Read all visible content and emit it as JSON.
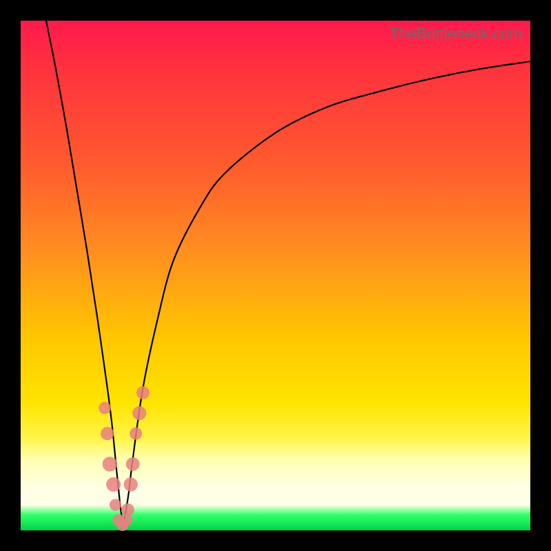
{
  "watermark": "TheBottleneck.com",
  "colors": {
    "frame": "#000000",
    "gradient_top": "#ff1a4d",
    "gradient_mid": "#ffc600",
    "gradient_band": "#ffffe8",
    "gradient_bottom": "#00d34a",
    "curve": "#000000",
    "dots": "#e98080"
  },
  "chart_data": {
    "type": "line",
    "title": "",
    "xlabel": "",
    "ylabel": "",
    "xlim": [
      0,
      100
    ],
    "ylim": [
      0,
      100
    ],
    "grid": false,
    "legend": false,
    "series": [
      {
        "name": "bottleneck-curve",
        "x": [
          5,
          7,
          9,
          11,
          13,
          15,
          17,
          18,
          19,
          20,
          21,
          22,
          24,
          27,
          30,
          35,
          40,
          50,
          60,
          70,
          80,
          90,
          100
        ],
        "y": [
          100,
          90,
          79,
          67,
          55,
          42,
          28,
          20,
          10,
          2,
          6,
          14,
          28,
          42,
          53,
          63,
          70,
          78,
          83,
          86,
          88.5,
          90.5,
          92
        ]
      }
    ],
    "highlight_points": {
      "name": "dip-cluster",
      "x": [
        16.5,
        17.0,
        17.5,
        18.2,
        18.6,
        19.2,
        20.0,
        20.7,
        21.0,
        21.6,
        22.0,
        22.6,
        23.3,
        24.0
      ],
      "y": [
        24,
        19,
        13,
        9,
        5,
        2,
        1,
        2,
        4,
        9,
        13,
        19,
        23,
        27
      ]
    }
  }
}
